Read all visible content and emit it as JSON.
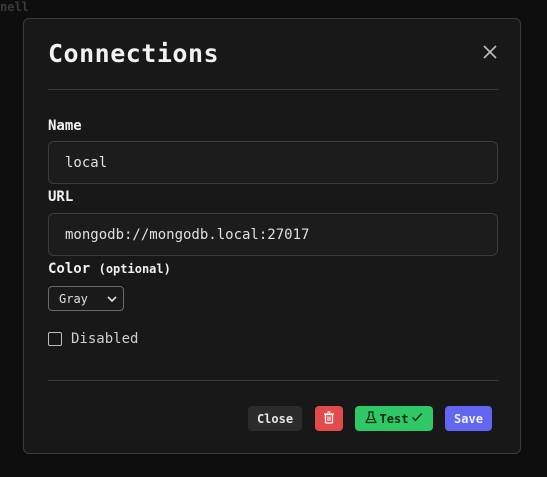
{
  "background": {
    "label": "nell"
  },
  "dialog": {
    "title": "Connections",
    "close_icon": "close-icon"
  },
  "form": {
    "name_label": "Name",
    "name_value": "local",
    "url_label": "URL",
    "url_value": "mongodb://mongodb.local:27017",
    "color_label": "Color",
    "color_optional": "(optional)",
    "color_value": "Gray",
    "disabled_label": "Disabled",
    "disabled_checked": false
  },
  "actions": {
    "close_label": "Close",
    "delete_icon": "trash-icon",
    "test_label": "Test",
    "test_icon_left": "flask-icon",
    "test_icon_right": "check-icon",
    "save_label": "Save"
  },
  "colors": {
    "delete": "#e24b4b",
    "test": "#2ec866",
    "save": "#6366f1"
  }
}
